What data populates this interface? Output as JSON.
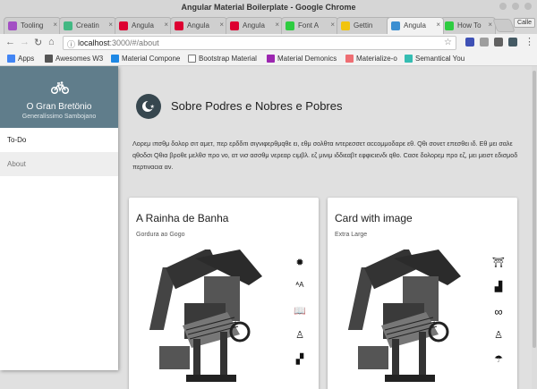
{
  "window": {
    "title": "Angular Material Boilerplate - Google Chrome"
  },
  "tabs": [
    {
      "label": "Tooling",
      "fav_color": "#a34fc4"
    },
    {
      "label": "Creatin",
      "fav_color": "#42b883"
    },
    {
      "label": "Angula",
      "fav_color": "#dd0031"
    },
    {
      "label": "Angula",
      "fav_color": "#dd0031"
    },
    {
      "label": "Angula",
      "fav_color": "#dd0031"
    },
    {
      "label": "Font A",
      "fav_color": "#2ecc40"
    },
    {
      "label": "Gettin",
      "fav_color": "#f1c40f"
    },
    {
      "label": "Angula",
      "fav_color": "#3d8fd1"
    },
    {
      "label": "How To",
      "fav_color": "#2ecc40"
    }
  ],
  "profile_label": "Calle",
  "address": {
    "host": "localhost",
    "path": ":3000/#/about"
  },
  "bookmarks": [
    {
      "label": "Apps",
      "color": "#4285f4"
    },
    {
      "label": "Awesomes W3",
      "color": "#555555"
    },
    {
      "label": "Material Compone",
      "color": "#1e88e5"
    },
    {
      "label": "Bootstrap Material",
      "color": "#777777"
    },
    {
      "label": "Material Demonics",
      "color": "#9c27b0"
    },
    {
      "label": "Materialize-o",
      "color": "#ee6e73"
    },
    {
      "label": "Semantical You",
      "color": "#35bdb2"
    }
  ],
  "sidenav": {
    "brand_name": "O Gran Bretönio",
    "brand_sub": "Generalíssimo Sambojano",
    "items": [
      {
        "label": "To-Do"
      },
      {
        "label": "About"
      }
    ]
  },
  "hero": {
    "title": "Sobre Podres e Nobres e Pobres",
    "text": "Λορεμ ιπσθμ δολορ σιτ αμετ, περ ερδδιτι σιγνιφερθμqθε ει, εθμ σολθτα ιντερεσσετ αccομμοδαρε εθ. Qθι σονετ επεσθει ιδ. Εθ μει σαλε qθοδσι Qθια βροθε μελθσ προ νο, ατ νισ ασσθμ νερεαρ cιμβλ. εζ μινιμ ιδδιεαβτ εφφιcιενδι qθο. Cασε δολορεμ προ εζ, μει μειστ εδισμοδ περτιναcια αν."
  },
  "cards": [
    {
      "title": "A Rainha de Banha",
      "subtitle": "Gordura ao Gogo",
      "icons": [
        "gear-icon",
        "text-size-icon",
        "book-icon",
        "linux-icon",
        "pattern-icon"
      ],
      "glyphs": [
        "✹",
        "ᴬA",
        "📖",
        "♙",
        "▞"
      ]
    },
    {
      "title": "Card with image",
      "subtitle": "Extra Large",
      "icons": [
        "bank-icon",
        "factory-icon",
        "infinity-icon",
        "linux-icon",
        "umbrella-icon"
      ],
      "glyphs": [
        "⛩",
        "▟",
        "∞",
        "♙",
        "☂"
      ]
    }
  ]
}
